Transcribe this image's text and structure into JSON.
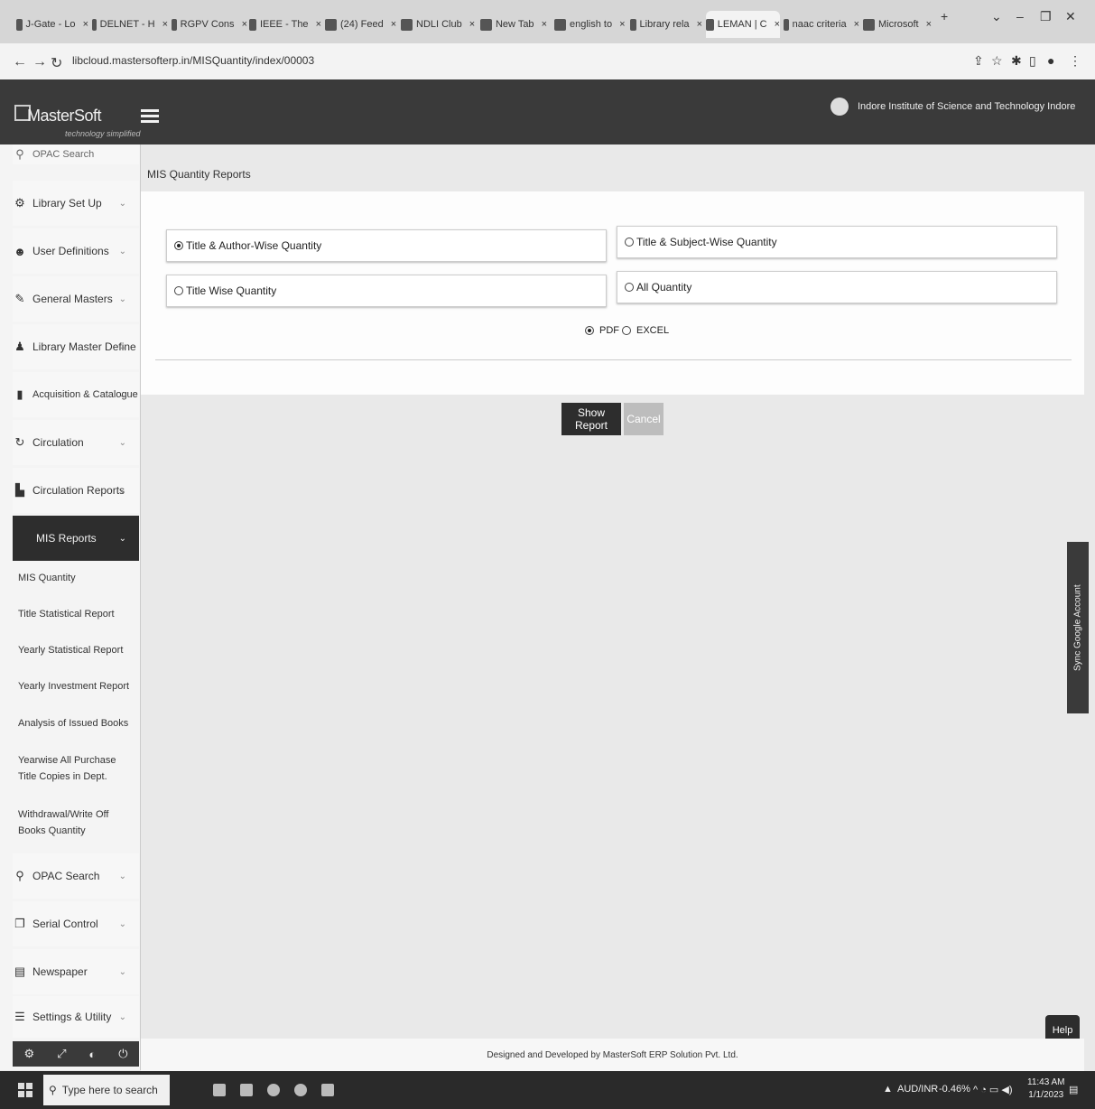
{
  "browser": {
    "tabs": [
      {
        "label": "J-Gate - Lo"
      },
      {
        "label": "DELNET - H"
      },
      {
        "label": "RGPV Cons"
      },
      {
        "label": "IEEE - The"
      },
      {
        "label": "(24) Feed"
      },
      {
        "label": "NDLI Club"
      },
      {
        "label": "New Tab"
      },
      {
        "label": "english to"
      },
      {
        "label": "Library rela"
      },
      {
        "label": "LEMAN | C"
      },
      {
        "label": "naac criteria"
      },
      {
        "label": "Microsoft"
      }
    ],
    "new_tab": "+",
    "url": "libcloud.mastersofterp.in/MISQuantity/index/00003"
  },
  "app": {
    "logo": "MasterSoft",
    "logo_tagline": "technology simplified",
    "institute": "Indore Institute of Science and Technology Indore"
  },
  "sidebar": {
    "top_partial": "OPAC Search",
    "items": [
      {
        "label": "Library Set Up",
        "icon": "gear-icon"
      },
      {
        "label": "User Definitions",
        "icon": "users-icon"
      },
      {
        "label": "General Masters",
        "icon": "edit-icon"
      },
      {
        "label": "Library Master Define",
        "icon": "people-icon"
      },
      {
        "label": "Acquisition & Catalogue",
        "icon": "book-icon"
      },
      {
        "label": "Circulation",
        "icon": "refresh-icon"
      },
      {
        "label": "Circulation Reports",
        "icon": "chart-icon"
      },
      {
        "label": "MIS Reports",
        "icon": ""
      },
      {
        "label": "OPAC Search",
        "icon": "search-icon"
      },
      {
        "label": "Serial Control",
        "icon": "copy-icon"
      },
      {
        "label": "Newspaper",
        "icon": "newspaper-icon"
      },
      {
        "label": "Settings & Utility",
        "icon": "sliders-icon"
      }
    ],
    "sub_items": [
      "MIS Quantity",
      "Title Statistical Report",
      "Yearly Statistical Report",
      "Yearly Investment Report",
      "Analysis of Issued Books",
      "Yearwise All Purchase Title Copies in Dept.",
      "Withdrawal/Write Off Books Quantity"
    ]
  },
  "main": {
    "breadcrumb": "MIS Quantity Reports",
    "options": [
      {
        "label": "Title & Author-Wise Quantity",
        "selected": true
      },
      {
        "label": "Title & Subject-Wise Quantity",
        "selected": false
      },
      {
        "label": "Title Wise Quantity",
        "selected": false
      },
      {
        "label": "All Quantity",
        "selected": false
      }
    ],
    "format": {
      "pdf": "PDF",
      "excel": "EXCEL",
      "selected": "PDF"
    },
    "show_report": "Show Report",
    "cancel": "Cancel"
  },
  "sync_tab": "Sync Google Account",
  "help": "Help",
  "footer": "Designed and Developed by MasterSoft ERP Solution Pvt. Ltd.",
  "taskbar": {
    "search_placeholder": "Type here to search",
    "currency": "AUD/INR",
    "currency_change": "-0.46%",
    "time": "11:43 AM",
    "date": "1/1/2023"
  }
}
